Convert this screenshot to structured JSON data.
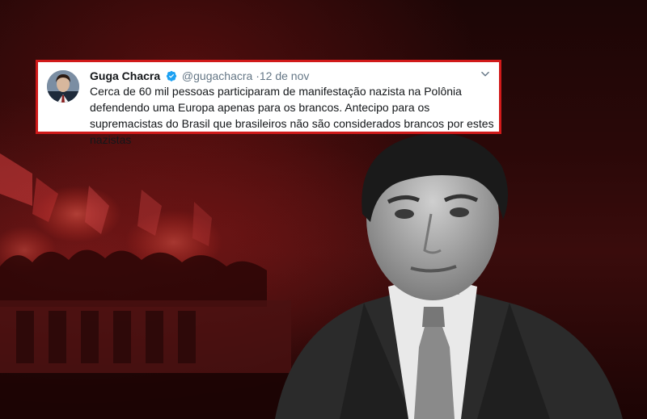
{
  "tweet": {
    "name": "Guga Chacra",
    "handle": "@gugachacra",
    "separator": "·",
    "date": "12 de nov",
    "text": "Cerca de 60 mil pessoas participaram de manifestação nazista na Polônia defendendo uma Europa apenas para os brancos. Antecipo para os supremacistas do Brasil que brasileiros não são considerados brancos por estes nazistas",
    "verified_color": "#1da1f2",
    "border_color": "#d11a1a"
  },
  "icons": {
    "verified": "verified-badge-icon",
    "menu": "chevron-down-icon"
  }
}
